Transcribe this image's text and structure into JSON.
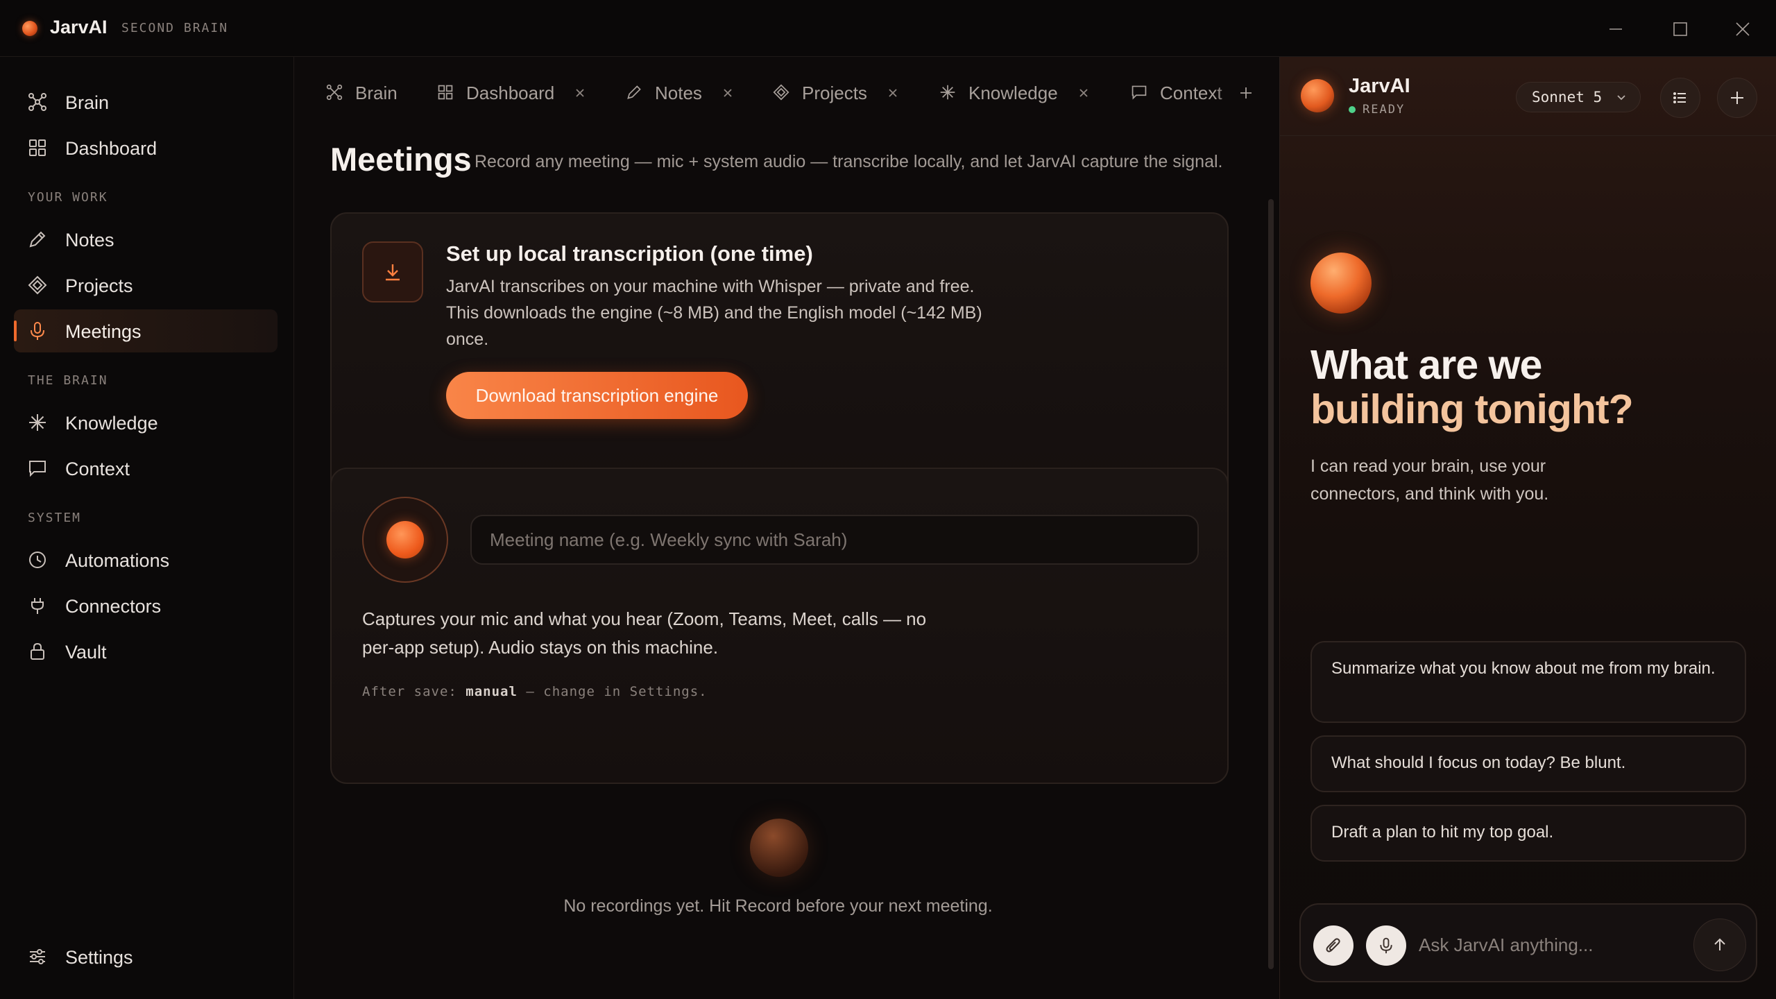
{
  "app": {
    "title": "JarvAI",
    "subtitle": "SECOND BRAIN"
  },
  "sidebar": {
    "top_items": [
      {
        "label": "Brain",
        "icon": "brain-network-icon"
      },
      {
        "label": "Dashboard",
        "icon": "grid-icon"
      }
    ],
    "sections": [
      {
        "label": "YOUR WORK",
        "items": [
          {
            "label": "Notes",
            "icon": "pencil-icon"
          },
          {
            "label": "Projects",
            "icon": "diamond-icon"
          },
          {
            "label": "Meetings",
            "icon": "microphone-icon",
            "active": true
          }
        ]
      },
      {
        "label": "THE BRAIN",
        "items": [
          {
            "label": "Knowledge",
            "icon": "asterisk-icon"
          },
          {
            "label": "Context",
            "icon": "speech-bubble-icon"
          }
        ]
      },
      {
        "label": "SYSTEM",
        "items": [
          {
            "label": "Automations",
            "icon": "clock-icon"
          },
          {
            "label": "Connectors",
            "icon": "plug-icon"
          },
          {
            "label": "Vault",
            "icon": "lock-icon"
          }
        ]
      }
    ],
    "settings_label": "Settings"
  },
  "tabs": [
    {
      "label": "Brain",
      "closable": false
    },
    {
      "label": "Dashboard",
      "closable": true
    },
    {
      "label": "Notes",
      "closable": true
    },
    {
      "label": "Projects",
      "closable": true
    },
    {
      "label": "Knowledge",
      "closable": true
    },
    {
      "label": "Context",
      "closable": false
    }
  ],
  "page": {
    "title": "Meetings",
    "description": "Record any meeting — mic + system audio — transcribe locally, and let JarvAI capture the signal."
  },
  "setup_card": {
    "title": "Set up local transcription (one time)",
    "body": "JarvAI transcribes on your machine with Whisper — private and free. This downloads the engine (~8 MB) and the English model (~142 MB) once.",
    "button": "Download transcription engine"
  },
  "record_card": {
    "input_placeholder": "Meeting name (e.g. Weekly sync with Sarah)",
    "body": "Captures your mic and what you hear (Zoom, Teams, Meet, calls — no per-app setup). Audio stays on this machine.",
    "after_prefix": "After save:",
    "after_value": "manual",
    "after_suffix": "— change in Settings."
  },
  "empty_state": "No recordings yet. Hit Record before your next meeting.",
  "assistant": {
    "name": "JarvAI",
    "status": "READY",
    "model": "Sonnet 5",
    "hero_line1": "What are we",
    "hero_line2": "building tonight?",
    "hero_sub": "I can read your brain, use your connectors, and think with you.",
    "suggestions": [
      "Summarize what you know about me from my brain.",
      "What should I focus on today? Be blunt.",
      "Draft a plan to hit my top goal."
    ],
    "input_placeholder": "Ask JarvAI anything..."
  },
  "colors": {
    "accent": "#ef6a2c",
    "accent_light": "#f4c49d",
    "ready": "#4fd18a",
    "background": "#0b0909"
  }
}
